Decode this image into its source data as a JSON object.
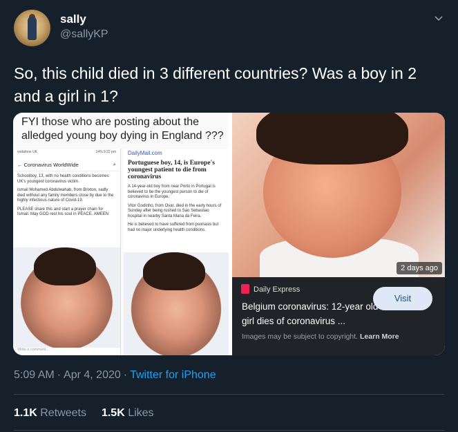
{
  "author": {
    "name": "sally",
    "handle": "@sallyKP"
  },
  "tweet": {
    "text": "So, this child died in 3 different countries? Was a boy in 2 and a girl in 1?"
  },
  "media": {
    "left": {
      "caption": "FYI those who are posting about the alledged young boy dying in England ???",
      "phone1": {
        "header_title": "Coronavirus WorldWide",
        "status_left": "vodafone UK",
        "status_right": "14% 9:22 pm",
        "paragraphs": [
          "Schoolboy, 13, with no health conditions becomes UK's youngest coronavirus victim.",
          "Ismail Mohamed Abdulwahab, from Brixton, sadly died without any family members close by due to the highly infectious nature of Covid-19.",
          "PLEASE share this and start a prayer chain for Ismail. May GOD rest his soul in PEACE. AMEEN"
        ],
        "comment_placeholder": "Write a comment..."
      },
      "phone2": {
        "logo": "DailyMail.com",
        "headline": "Portuguese boy, 14, is Europe's youngest patient to die from coronavirus",
        "paragraphs": [
          "A 14-year-old boy from near Porto in Portugal is believed to be the youngest person to die of coronavirus in Europe.",
          "Vitor Godinho, from Ovar, died in the early hours of Sunday after being rushed to Sao Sebastiao hospital in nearby Santa Maria da Feira.",
          "He is believed to have suffered from psoriasis but had no major underlying health conditions."
        ]
      }
    },
    "right": {
      "time_badge": "2 days ago",
      "source": "Daily Express",
      "title": "Belgium coronavirus: 12-year old girl dies of coronavirus ...",
      "visit_label": "Visit",
      "copyright_prefix": "Images may be subject to copyright.",
      "learn_more": "Learn More"
    }
  },
  "meta": {
    "time": "5:09 AM",
    "date": "Apr 4, 2020",
    "separator": "·",
    "source": "Twitter for iPhone"
  },
  "stats": {
    "retweets_count": "1.1K",
    "retweets_label": "Retweets",
    "likes_count": "1.5K",
    "likes_label": "Likes"
  },
  "colors": {
    "background": "#15202b",
    "secondary_text": "#8899a6",
    "link": "#1da1f2",
    "divider": "#38444d"
  }
}
